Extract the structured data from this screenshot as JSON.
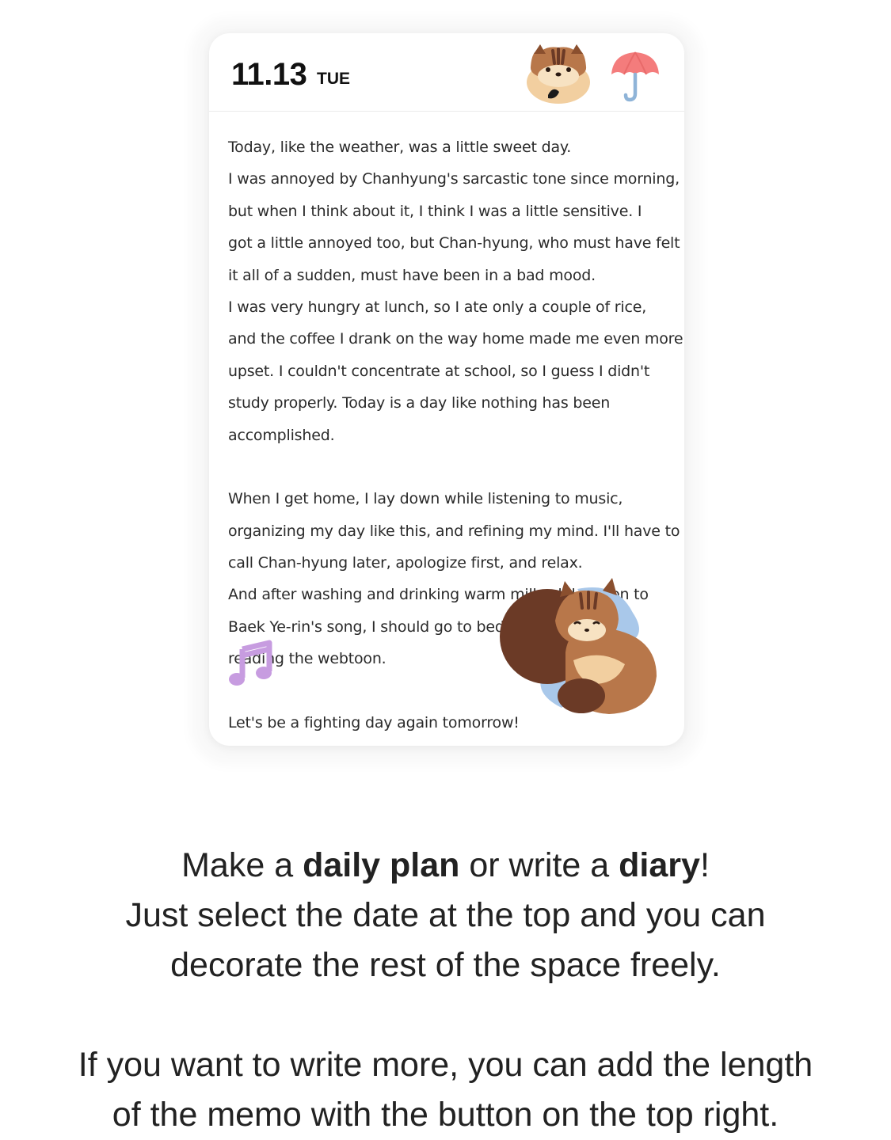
{
  "header": {
    "date": "11.13",
    "weekday": "TUE",
    "sticker_icon": "squirrel-sticker-icon",
    "weather_icon": "umbrella-icon"
  },
  "diary": {
    "lines": [
      "Today, like the weather, was a little sweet day.",
      "I was annoyed by Chanhyung's sarcastic tone since morning,",
      "but when I think about it, I think I was a little sensitive. I",
      "got a little annoyed too, but Chan-hyung, who must have felt",
      "it all of a sudden, must have been in a bad mood.",
      "I was very hungry at lunch, so I ate only a couple of rice,",
      "and the coffee I drank on the way home made me even more",
      "upset. I couldn't concentrate at school, so I guess I didn't",
      "study properly. Today is a day like nothing has been",
      "accomplished.",
      "",
      "When I get home, I lay down while listening to music,",
      "organizing my day like this, and refining my mind. I'll have to",
      "call Chan-hyung later, apologize first, and relax.",
      "And after washing and drinking warm milk while listen to",
      "Baek Ye-rin's song, I should go to bed e",
      "reading the webtoon.",
      "",
      "Let's be a fighting day again tomorrow!"
    ],
    "stickers": [
      "sleeping-squirrel-icon",
      "music-note-icon"
    ]
  },
  "caption": {
    "line1_pre": "Make a ",
    "line1_bold1": "daily plan",
    "line1_mid": " or write a ",
    "line1_bold2": "diary",
    "line1_post": "!",
    "line2": "Just select the date at the top and you can",
    "line3": "decorate the rest of the space freely.",
    "line5": "If you want to write more, you can add the length",
    "line6": "of the memo with the button on the top right."
  },
  "colors": {
    "umbrella": "#f47c7c",
    "umbrella_handle": "#8fb4d8",
    "squirrel_brown": "#b8774a",
    "squirrel_dark": "#6b3a26",
    "music_note": "#c79ce0",
    "pillow_blue": "#a9c8ea"
  }
}
